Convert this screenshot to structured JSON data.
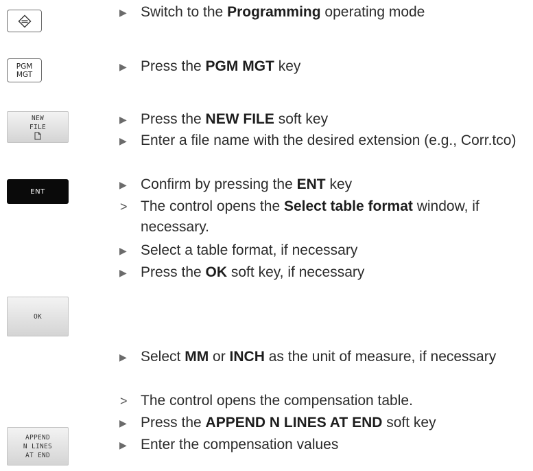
{
  "keys": {
    "mode_key": "Programming mode key",
    "pgm_mgt_line1": "PGM",
    "pgm_mgt_line2": "MGT",
    "new_file_line1": "NEW",
    "new_file_line2": "FILE",
    "ent": "ENT",
    "ok": "OK",
    "append_line1": "APPEND",
    "append_line2": "N LINES",
    "append_line3": "AT END"
  },
  "markers": {
    "action": "▶",
    "result": ">"
  },
  "steps": [
    {
      "pre": "Switch to the ",
      "bold": "Programming",
      "post": " operating mode"
    },
    {
      "pre": "Press the ",
      "bold": "PGM MGT",
      "post": " key"
    },
    {
      "pre": "Press the ",
      "bold": "NEW FILE",
      "post": " soft key"
    },
    {
      "pre": "Enter a file name with the desired extension (e.g., Corr.tco)"
    },
    {
      "pre": "Confirm by pressing the ",
      "bold": "ENT",
      "post": " key"
    },
    {
      "pre": "The control opens the ",
      "bold": "Select table format",
      "post": " window, if necessary."
    },
    {
      "pre": "Select a table format, if necessary"
    },
    {
      "pre": "Press the ",
      "bold": "OK",
      "post": " soft key, if necessary"
    },
    {
      "pre": "Select ",
      "bold": "MM",
      "mid": " or ",
      "bold2": "INCH",
      "post": " as the unit of measure, if necessary"
    },
    {
      "pre": "The control opens the compensation table."
    },
    {
      "pre": "Press the ",
      "bold": "APPEND N LINES AT END",
      "post": " soft key"
    },
    {
      "pre": "Enter the compensation values"
    }
  ]
}
